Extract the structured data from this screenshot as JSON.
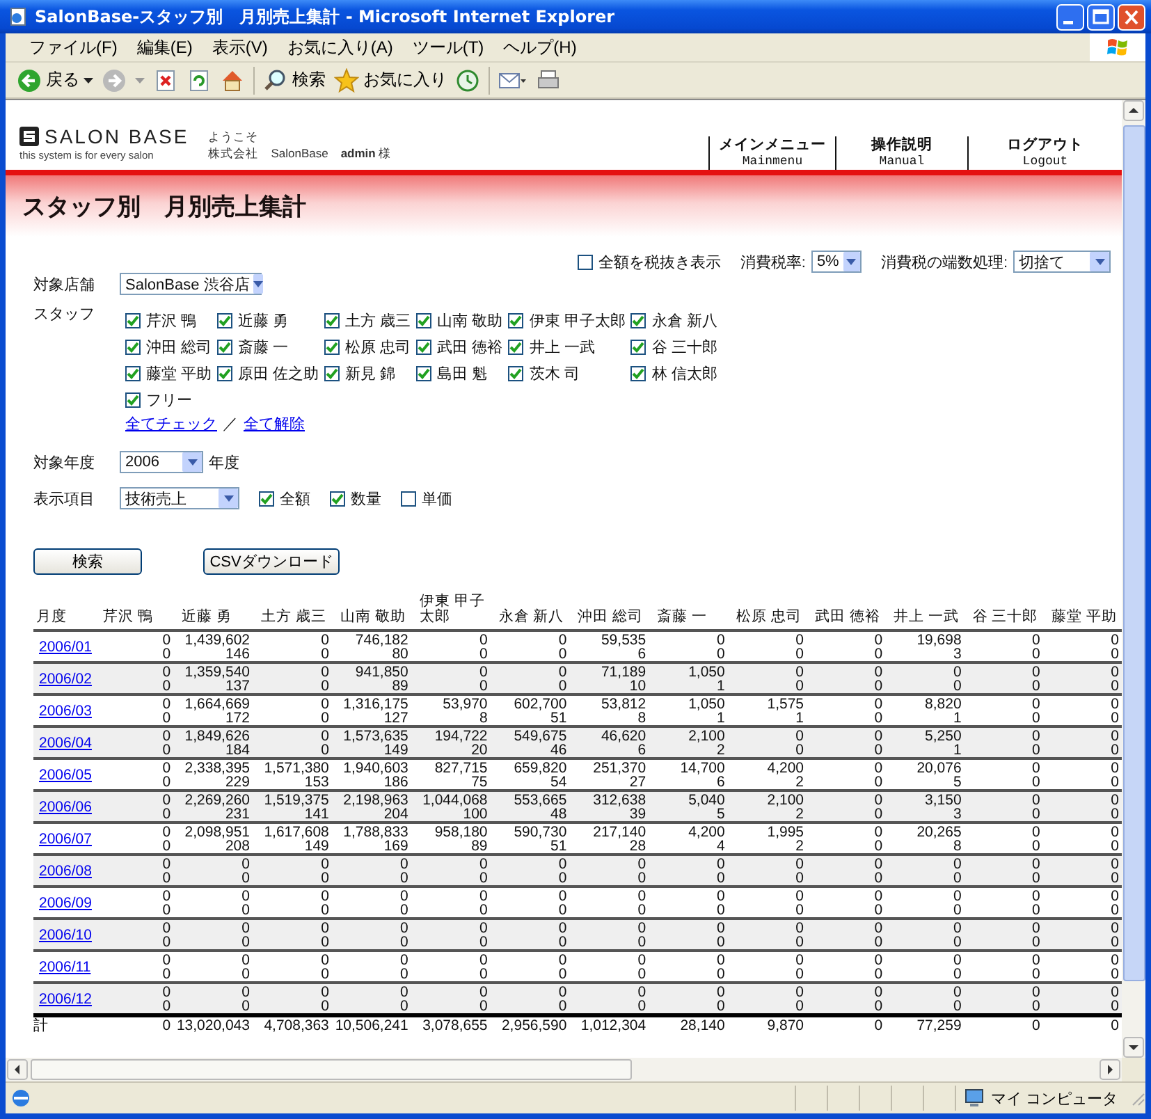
{
  "window": {
    "title": "SalonBase-スタッフ別　月別売上集計 - Microsoft Internet Explorer"
  },
  "menu": [
    "ファイル(F)",
    "編集(E)",
    "表示(V)",
    "お気に入り(A)",
    "ツール(T)",
    "ヘルプ(H)"
  ],
  "toolbar": [
    {
      "kind": "back",
      "label": "戻る"
    },
    {
      "kind": "forward"
    },
    {
      "kind": "stop"
    },
    {
      "kind": "refresh"
    },
    {
      "kind": "home"
    },
    {
      "kind": "search",
      "label": "検索"
    },
    {
      "kind": "favorites",
      "label": "お気に入り"
    },
    {
      "kind": "history"
    },
    {
      "kind": "mail"
    },
    {
      "kind": "print"
    }
  ],
  "header": {
    "logo": "SALON BASE",
    "tagline": "this system is for every salon",
    "welcome": "ようこそ",
    "user_line": "株式会社　SalonBase　**admin** 様",
    "nav": [
      {
        "label": "メインメニュー",
        "sub": "Mainmenu"
      },
      {
        "label": "操作説明",
        "sub": "Manual"
      },
      {
        "label": "ログアウト",
        "sub": "Logout"
      }
    ]
  },
  "page_title": "スタッフ別　月別売上集計",
  "options": {
    "tax_exclusive": {
      "label": "全額を税抜き表示",
      "checked": false
    },
    "tax_rate": {
      "label": "消費税率:",
      "value": "5%"
    },
    "rounding": {
      "label": "消費税の端数処理:",
      "value": "切捨て"
    }
  },
  "store": {
    "label": "対象店舗",
    "value": "SalonBase 渋谷店"
  },
  "staff": {
    "label": "スタッフ",
    "members": [
      {
        "name": "芹沢 鴨",
        "checked": true
      },
      {
        "name": "近藤 勇",
        "checked": true
      },
      {
        "name": "土方 歳三",
        "checked": true
      },
      {
        "name": "山南 敬助",
        "checked": true
      },
      {
        "name": "伊東 甲子太郎",
        "checked": true
      },
      {
        "name": "永倉 新八",
        "checked": true
      },
      {
        "name": "沖田 総司",
        "checked": true
      },
      {
        "name": "斎藤 一",
        "checked": true
      },
      {
        "name": "松原 忠司",
        "checked": true
      },
      {
        "name": "武田 徳裕",
        "checked": true
      },
      {
        "name": "井上 一武",
        "checked": true
      },
      {
        "name": "谷 三十郎",
        "checked": true
      },
      {
        "name": "藤堂 平助",
        "checked": true
      },
      {
        "name": "原田 佐之助",
        "checked": true
      },
      {
        "name": "新見 錦",
        "checked": true
      },
      {
        "name": "島田 魁",
        "checked": true
      },
      {
        "name": "茨木 司",
        "checked": true
      },
      {
        "name": "林 信太郎",
        "checked": true
      },
      {
        "name": "フリー",
        "checked": true
      }
    ],
    "check_all": "全てチェック",
    "separator": "／",
    "clear_all": "全て解除"
  },
  "year": {
    "label": "対象年度",
    "value": "2006",
    "suffix": "年度"
  },
  "display": {
    "label": "表示項目",
    "value": "技術売上",
    "fields": [
      {
        "label": "全額",
        "checked": true
      },
      {
        "label": "数量",
        "checked": true
      },
      {
        "label": "単価",
        "checked": false
      }
    ]
  },
  "buttons": [
    "検索",
    "CSVダウンロード"
  ],
  "table": {
    "month_header": "月度",
    "columns": [
      "芹沢 鴨",
      "近藤 勇",
      "土方 歳三",
      "山南 敬助",
      "伊東 甲子太郎",
      "永倉 新八",
      "沖田 総司",
      "斎藤 一",
      "松原 忠司",
      "武田 徳裕",
      "井上 一武",
      "谷 三十郎",
      "藤堂 平助"
    ],
    "rows": [
      {
        "month": "2006/01",
        "cells": [
          [
            "0",
            "0"
          ],
          [
            "1,439,602",
            "146"
          ],
          [
            "0",
            "0"
          ],
          [
            "746,182",
            "80"
          ],
          [
            "0",
            "0"
          ],
          [
            "0",
            "0"
          ],
          [
            "59,535",
            "6"
          ],
          [
            "0",
            "0"
          ],
          [
            "0",
            "0"
          ],
          [
            "0",
            "0"
          ],
          [
            "19,698",
            "3"
          ],
          [
            "0",
            "0"
          ],
          [
            "0",
            "0"
          ]
        ]
      },
      {
        "month": "2006/02",
        "cells": [
          [
            "0",
            "0"
          ],
          [
            "1,359,540",
            "137"
          ],
          [
            "0",
            "0"
          ],
          [
            "941,850",
            "89"
          ],
          [
            "0",
            "0"
          ],
          [
            "0",
            "0"
          ],
          [
            "71,189",
            "10"
          ],
          [
            "1,050",
            "1"
          ],
          [
            "0",
            "0"
          ],
          [
            "0",
            "0"
          ],
          [
            "0",
            "0"
          ],
          [
            "0",
            "0"
          ],
          [
            "0",
            "0"
          ]
        ]
      },
      {
        "month": "2006/03",
        "cells": [
          [
            "0",
            "0"
          ],
          [
            "1,664,669",
            "172"
          ],
          [
            "0",
            "0"
          ],
          [
            "1,316,175",
            "127"
          ],
          [
            "53,970",
            "8"
          ],
          [
            "602,700",
            "51"
          ],
          [
            "53,812",
            "8"
          ],
          [
            "1,050",
            "1"
          ],
          [
            "1,575",
            "1"
          ],
          [
            "0",
            "0"
          ],
          [
            "8,820",
            "1"
          ],
          [
            "0",
            "0"
          ],
          [
            "0",
            "0"
          ]
        ]
      },
      {
        "month": "2006/04",
        "cells": [
          [
            "0",
            "0"
          ],
          [
            "1,849,626",
            "184"
          ],
          [
            "0",
            "0"
          ],
          [
            "1,573,635",
            "149"
          ],
          [
            "194,722",
            "20"
          ],
          [
            "549,675",
            "46"
          ],
          [
            "46,620",
            "6"
          ],
          [
            "2,100",
            "2"
          ],
          [
            "0",
            "0"
          ],
          [
            "0",
            "0"
          ],
          [
            "5,250",
            "1"
          ],
          [
            "0",
            "0"
          ],
          [
            "0",
            "0"
          ]
        ]
      },
      {
        "month": "2006/05",
        "cells": [
          [
            "0",
            "0"
          ],
          [
            "2,338,395",
            "229"
          ],
          [
            "1,571,380",
            "153"
          ],
          [
            "1,940,603",
            "186"
          ],
          [
            "827,715",
            "75"
          ],
          [
            "659,820",
            "54"
          ],
          [
            "251,370",
            "27"
          ],
          [
            "14,700",
            "6"
          ],
          [
            "4,200",
            "2"
          ],
          [
            "0",
            "0"
          ],
          [
            "20,076",
            "5"
          ],
          [
            "0",
            "0"
          ],
          [
            "0",
            "0"
          ]
        ]
      },
      {
        "month": "2006/06",
        "cells": [
          [
            "0",
            "0"
          ],
          [
            "2,269,260",
            "231"
          ],
          [
            "1,519,375",
            "141"
          ],
          [
            "2,198,963",
            "204"
          ],
          [
            "1,044,068",
            "100"
          ],
          [
            "553,665",
            "48"
          ],
          [
            "312,638",
            "39"
          ],
          [
            "5,040",
            "5"
          ],
          [
            "2,100",
            "2"
          ],
          [
            "0",
            "0"
          ],
          [
            "3,150",
            "3"
          ],
          [
            "0",
            "0"
          ],
          [
            "0",
            "0"
          ]
        ]
      },
      {
        "month": "2006/07",
        "cells": [
          [
            "0",
            "0"
          ],
          [
            "2,098,951",
            "208"
          ],
          [
            "1,617,608",
            "149"
          ],
          [
            "1,788,833",
            "169"
          ],
          [
            "958,180",
            "89"
          ],
          [
            "590,730",
            "51"
          ],
          [
            "217,140",
            "28"
          ],
          [
            "4,200",
            "4"
          ],
          [
            "1,995",
            "2"
          ],
          [
            "0",
            "0"
          ],
          [
            "20,265",
            "8"
          ],
          [
            "0",
            "0"
          ],
          [
            "0",
            "0"
          ]
        ]
      },
      {
        "month": "2006/08",
        "cells": [
          [
            "0",
            "0"
          ],
          [
            "0",
            "0"
          ],
          [
            "0",
            "0"
          ],
          [
            "0",
            "0"
          ],
          [
            "0",
            "0"
          ],
          [
            "0",
            "0"
          ],
          [
            "0",
            "0"
          ],
          [
            "0",
            "0"
          ],
          [
            "0",
            "0"
          ],
          [
            "0",
            "0"
          ],
          [
            "0",
            "0"
          ],
          [
            "0",
            "0"
          ],
          [
            "0",
            "0"
          ]
        ]
      },
      {
        "month": "2006/09",
        "cells": [
          [
            "0",
            "0"
          ],
          [
            "0",
            "0"
          ],
          [
            "0",
            "0"
          ],
          [
            "0",
            "0"
          ],
          [
            "0",
            "0"
          ],
          [
            "0",
            "0"
          ],
          [
            "0",
            "0"
          ],
          [
            "0",
            "0"
          ],
          [
            "0",
            "0"
          ],
          [
            "0",
            "0"
          ],
          [
            "0",
            "0"
          ],
          [
            "0",
            "0"
          ],
          [
            "0",
            "0"
          ]
        ]
      },
      {
        "month": "2006/10",
        "cells": [
          [
            "0",
            "0"
          ],
          [
            "0",
            "0"
          ],
          [
            "0",
            "0"
          ],
          [
            "0",
            "0"
          ],
          [
            "0",
            "0"
          ],
          [
            "0",
            "0"
          ],
          [
            "0",
            "0"
          ],
          [
            "0",
            "0"
          ],
          [
            "0",
            "0"
          ],
          [
            "0",
            "0"
          ],
          [
            "0",
            "0"
          ],
          [
            "0",
            "0"
          ],
          [
            "0",
            "0"
          ]
        ]
      },
      {
        "month": "2006/11",
        "cells": [
          [
            "0",
            "0"
          ],
          [
            "0",
            "0"
          ],
          [
            "0",
            "0"
          ],
          [
            "0",
            "0"
          ],
          [
            "0",
            "0"
          ],
          [
            "0",
            "0"
          ],
          [
            "0",
            "0"
          ],
          [
            "0",
            "0"
          ],
          [
            "0",
            "0"
          ],
          [
            "0",
            "0"
          ],
          [
            "0",
            "0"
          ],
          [
            "0",
            "0"
          ],
          [
            "0",
            "0"
          ]
        ]
      },
      {
        "month": "2006/12",
        "cells": [
          [
            "0",
            "0"
          ],
          [
            "0",
            "0"
          ],
          [
            "0",
            "0"
          ],
          [
            "0",
            "0"
          ],
          [
            "0",
            "0"
          ],
          [
            "0",
            "0"
          ],
          [
            "0",
            "0"
          ],
          [
            "0",
            "0"
          ],
          [
            "0",
            "0"
          ],
          [
            "0",
            "0"
          ],
          [
            "0",
            "0"
          ],
          [
            "0",
            "0"
          ],
          [
            "0",
            "0"
          ]
        ]
      }
    ],
    "total": {
      "label": "計",
      "cells": [
        "0",
        "13,020,043",
        "4,708,363",
        "10,506,241",
        "3,078,655",
        "2,956,590",
        "1,012,304",
        "28,140",
        "9,870",
        "0",
        "77,259",
        "0",
        "0"
      ]
    }
  },
  "status_bar": {
    "zone": "マイ コンピュータ"
  }
}
